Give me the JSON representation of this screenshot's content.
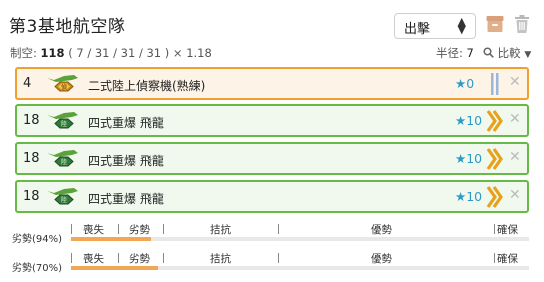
{
  "header": {
    "title": "第3基地航空隊",
    "mode_value": "出擊",
    "archive_icon": "archive-icon",
    "trash_icon": "trash-icon"
  },
  "summary": {
    "air_label": "制空:",
    "air_value": "118",
    "air_detail": "( 7 / 31 / 31 / 31 ) × 1.18",
    "radius_label": "半径:",
    "radius_value": "7",
    "compare_label": "比較"
  },
  "slots": [
    {
      "count": "4",
      "name": "二式陸上偵察機(熟練)",
      "star": "★0",
      "type": "recon",
      "proficiency": "recon",
      "remove": "✕"
    },
    {
      "count": "18",
      "name": "四式重爆 飛龍",
      "star": "★10",
      "type": "bomber",
      "proficiency": "max",
      "remove": "✕"
    },
    {
      "count": "18",
      "name": "四式重爆 飛龍",
      "star": "★10",
      "type": "bomber",
      "proficiency": "max",
      "remove": "✕"
    },
    {
      "count": "18",
      "name": "四式重爆 飛龍",
      "star": "★10",
      "type": "bomber",
      "proficiency": "max",
      "remove": "✕"
    }
  ],
  "air_states": {
    "tick_labels": [
      "喪失",
      "劣勢",
      "拮抗",
      "優勢",
      "確保"
    ],
    "rows": [
      {
        "label": "劣勢(94%)",
        "fill_fraction": 0.175
      },
      {
        "label": "劣勢(70%)",
        "fill_fraction": 0.19
      }
    ]
  },
  "colors": {
    "recon_border": "#f0a030",
    "bomber_border": "#66bb44",
    "star": "#2d9bc7",
    "bar_fill": "#f0a856"
  }
}
